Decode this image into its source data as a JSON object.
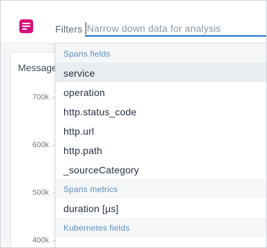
{
  "topbar": {
    "app_icon": "dashboard-icon",
    "filters_label": "Filters",
    "filter_input": {
      "value": "",
      "placeholder": "Narrow down data for analysis"
    }
  },
  "panel": {
    "title": "Message",
    "y_ticks": [
      "700k",
      "600k",
      "500k",
      "400k"
    ]
  },
  "dropdown": {
    "sections": [
      {
        "header": "Spans fields",
        "options": [
          "service",
          "operation",
          "http.status_code",
          "http.url",
          "http.path",
          "_sourceCategory"
        ]
      },
      {
        "header": "Spans metrics",
        "options": [
          "duration [µs]"
        ]
      },
      {
        "header": "Kubernetes fields",
        "options": []
      }
    ],
    "highlighted_option": "service"
  },
  "colors": {
    "accent": "#1a73c9",
    "brand_icon": "#d6117a",
    "section_header_text": "#5c8fbe",
    "highlight_bg": "#e9edf1"
  }
}
